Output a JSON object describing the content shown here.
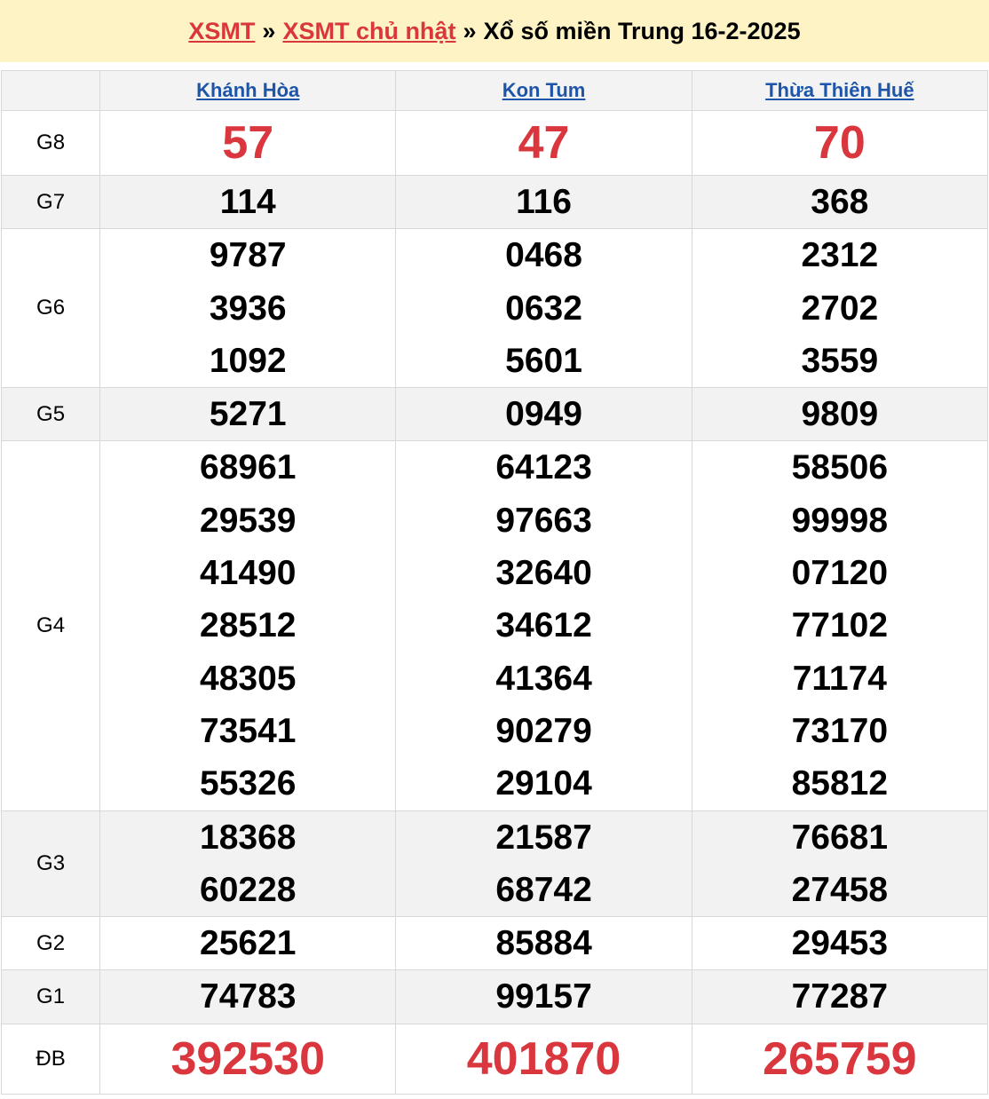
{
  "breadcrumb": {
    "link1": "XSMT",
    "sep1": "»",
    "link2": "XSMT chủ nhật",
    "sep2": "»",
    "title": "Xổ số miền Trung 16-2-2025"
  },
  "provinces": [
    "Khánh Hòa",
    "Kon Tum",
    "Thừa Thiên Huế"
  ],
  "prizes": [
    {
      "label": "G8",
      "values": [
        [
          "57"
        ],
        [
          "47"
        ],
        [
          "70"
        ]
      ]
    },
    {
      "label": "G7",
      "values": [
        [
          "114"
        ],
        [
          "116"
        ],
        [
          "368"
        ]
      ]
    },
    {
      "label": "G6",
      "values": [
        [
          "9787",
          "3936",
          "1092"
        ],
        [
          "0468",
          "0632",
          "5601"
        ],
        [
          "2312",
          "2702",
          "3559"
        ]
      ]
    },
    {
      "label": "G5",
      "values": [
        [
          "5271"
        ],
        [
          "0949"
        ],
        [
          "9809"
        ]
      ]
    },
    {
      "label": "G4",
      "values": [
        [
          "68961",
          "29539",
          "41490",
          "28512",
          "48305",
          "73541",
          "55326"
        ],
        [
          "64123",
          "97663",
          "32640",
          "34612",
          "41364",
          "90279",
          "29104"
        ],
        [
          "58506",
          "99998",
          "07120",
          "77102",
          "71174",
          "73170",
          "85812"
        ]
      ]
    },
    {
      "label": "G3",
      "values": [
        [
          "18368",
          "60228"
        ],
        [
          "21587",
          "68742"
        ],
        [
          "76681",
          "27458"
        ]
      ]
    },
    {
      "label": "G2",
      "values": [
        [
          "25621"
        ],
        [
          "85884"
        ],
        [
          "29453"
        ]
      ]
    },
    {
      "label": "G1",
      "values": [
        [
          "74783"
        ],
        [
          "99157"
        ],
        [
          "77287"
        ]
      ]
    },
    {
      "label": "ĐB",
      "values": [
        [
          "392530"
        ],
        [
          "401870"
        ],
        [
          "265759"
        ]
      ]
    }
  ],
  "colors": {
    "accent_red": "#d9363e",
    "link_blue": "#1e55a8",
    "header_bg": "#fdf3c4"
  }
}
